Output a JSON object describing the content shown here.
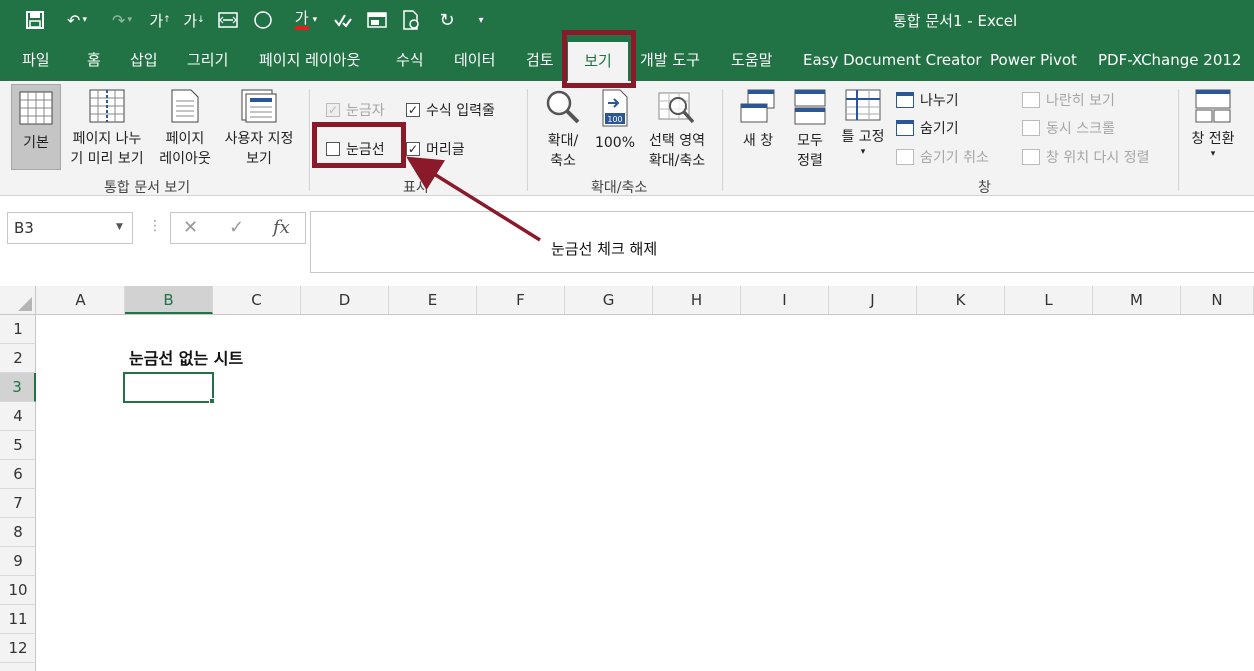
{
  "window": {
    "title": "통합 문서1  -  Excel"
  },
  "qat": {
    "font_increase": "가",
    "font_decrease": "가",
    "font_color": "가"
  },
  "tabs": [
    {
      "label": "파일"
    },
    {
      "label": "홈"
    },
    {
      "label": "삽입"
    },
    {
      "label": "그리기"
    },
    {
      "label": "페이지 레이아웃"
    },
    {
      "label": "수식"
    },
    {
      "label": "데이터"
    },
    {
      "label": "검토"
    },
    {
      "label": "보기",
      "active": true
    },
    {
      "label": "개발 도구"
    },
    {
      "label": "도움말"
    },
    {
      "label": "Easy Document Creator"
    },
    {
      "label": "Power Pivot"
    },
    {
      "label": "PDF-XChange 2012"
    }
  ],
  "ribbon": {
    "workbook_views": {
      "group_label": "통합 문서 보기",
      "normal": "기본",
      "page_break_1": "페이지 나누",
      "page_break_2": "기 미리 보기",
      "page_layout_1": "페이지",
      "page_layout_2": "레이아웃",
      "custom_1": "사용자 지정",
      "custom_2": "보기"
    },
    "show": {
      "group_label": "표시",
      "ruler": "눈금자",
      "formula_bar": "수식 입력줄",
      "gridlines": "눈금선",
      "headings": "머리글"
    },
    "zoom": {
      "group_label": "확대/축소",
      "zoom_1": "확대/",
      "zoom_2": "축소",
      "zoom_100": "100%",
      "zoom_sel_1": "선택 영역",
      "zoom_sel_2": "확대/축소",
      "icon_100": "100"
    },
    "window": {
      "group_label": "창",
      "new_window": "새 창",
      "arrange_1": "모두",
      "arrange_2": "정렬",
      "freeze": "틀 고정",
      "split": "나누기",
      "hide": "숨기기",
      "unhide": "숨기기 취소",
      "side_by_side": "나란히 보기",
      "sync_scroll": "동시 스크롤",
      "reset_pos": "창 위치 다시 정렬",
      "switch": "창 전환"
    }
  },
  "formula_bar": {
    "namebox": "B3",
    "cancel": "✕",
    "enter": "✓",
    "fx": "fx"
  },
  "annotation": {
    "text": "눈금선 체크 해제"
  },
  "grid": {
    "columns": [
      "A",
      "B",
      "C",
      "D",
      "E",
      "F",
      "G",
      "H",
      "I",
      "J",
      "K",
      "L",
      "M",
      "N"
    ],
    "rows": [
      "1",
      "2",
      "3",
      "4",
      "5",
      "6",
      "7",
      "8",
      "9",
      "10",
      "11",
      "12"
    ],
    "cell_b2": "눈금선 없는 시트",
    "selected_column": "B",
    "selected_row": "3"
  },
  "colors": {
    "excel_green": "#217346",
    "highlight": "#8a1a2a"
  }
}
